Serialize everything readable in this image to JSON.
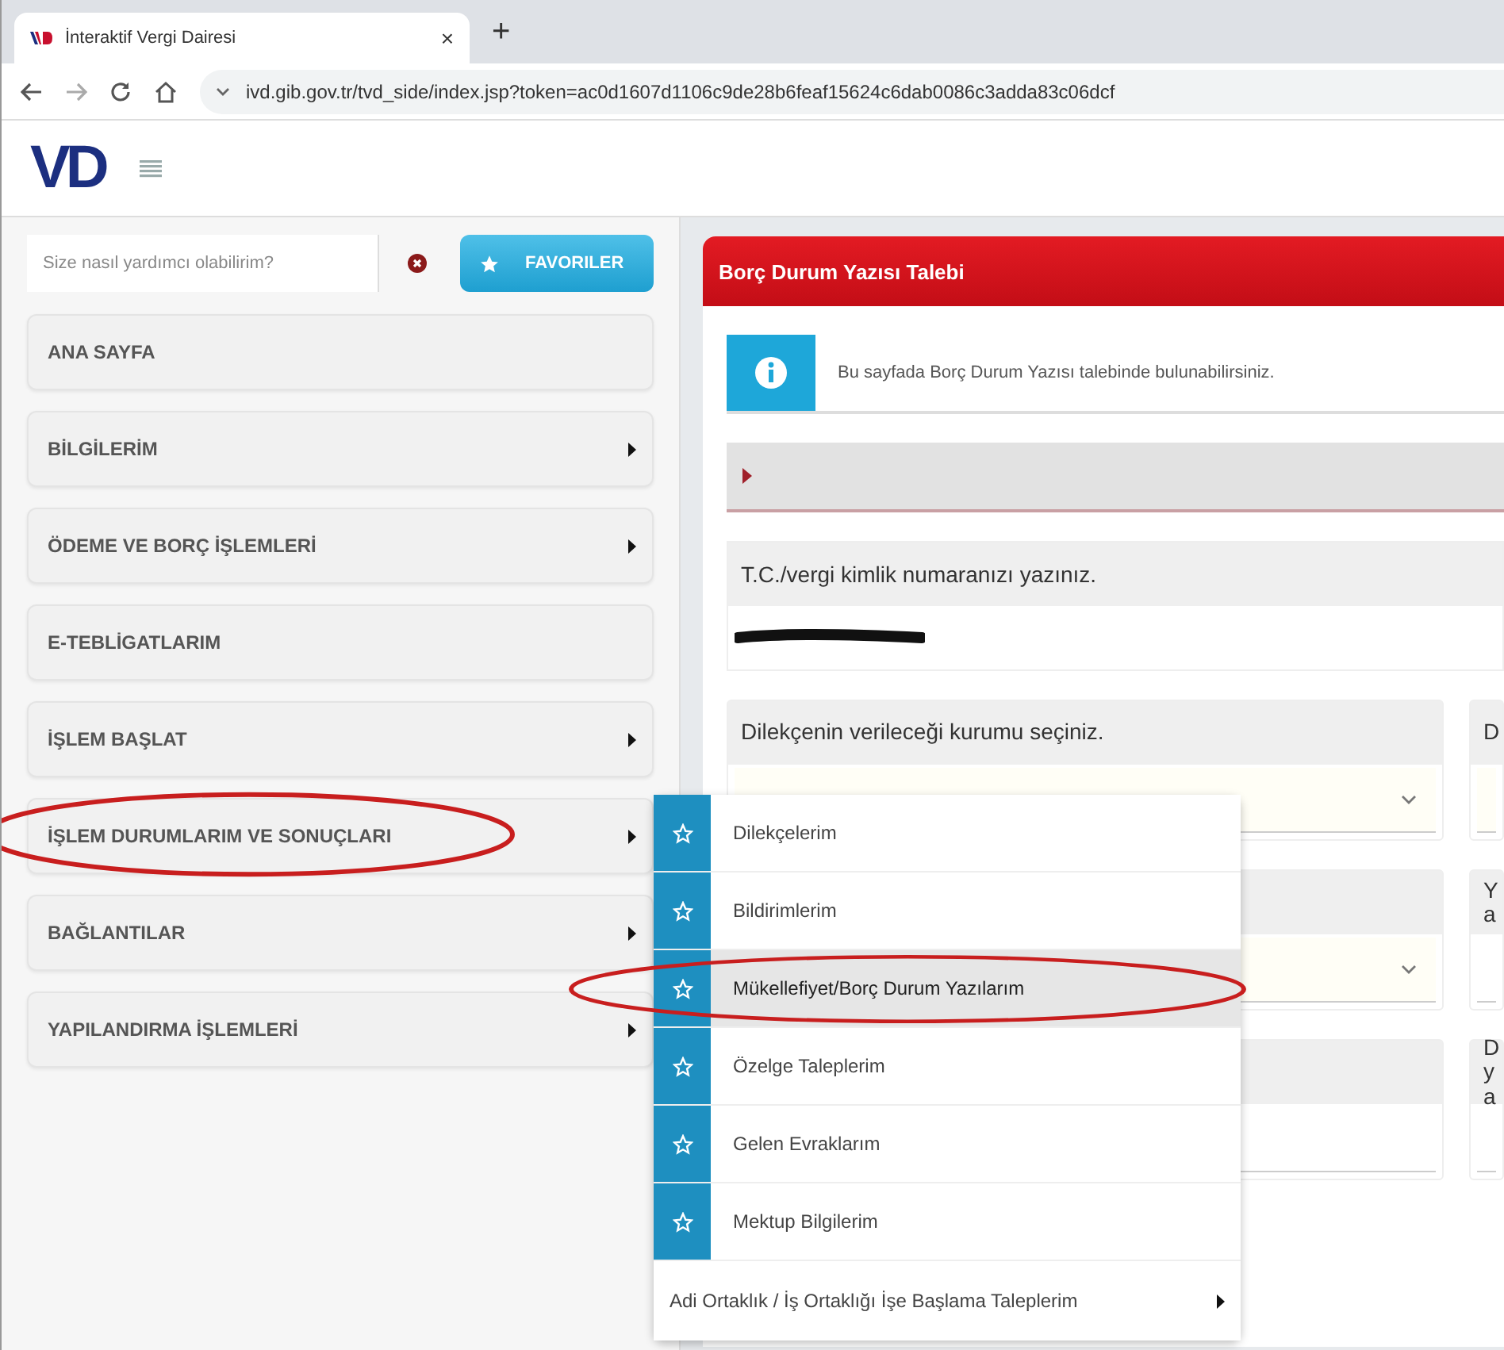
{
  "browser": {
    "tab": {
      "title": "İnteraktif Vergi Dairesi",
      "close": "×"
    },
    "new_tab": "+",
    "address": "ivd.gib.gov.tr/tvd_side/index.jsp?token=ac0d1607d1106c9de28b6feaf15624c6dab0086c3adda83c06dcf"
  },
  "header": {
    "logo": "VD"
  },
  "sidebar": {
    "search": {
      "placeholder": "Size nasıl yardımcı olabilirim?"
    },
    "favorites_button": "FAVORILER",
    "items": [
      {
        "label": "ANA SAYFA",
        "has_submenu": false,
        "circled": false
      },
      {
        "label": "BİLGİLERİM",
        "has_submenu": true,
        "circled": false
      },
      {
        "label": "ÖDEME VE BORÇ İŞLEMLERİ",
        "has_submenu": true,
        "circled": false
      },
      {
        "label": "E-TEBLİGATLARIM",
        "has_submenu": false,
        "circled": false
      },
      {
        "label": "İŞLEM BAŞLAT",
        "has_submenu": true,
        "circled": false
      },
      {
        "label": "İŞLEM DURUMLARIM VE SONUÇLARI",
        "has_submenu": true,
        "circled": true
      },
      {
        "label": "BAĞLANTILAR",
        "has_submenu": true,
        "circled": false
      },
      {
        "label": "YAPILANDIRMA İŞLEMLERİ",
        "has_submenu": true,
        "circled": false
      }
    ]
  },
  "submenu": {
    "items": [
      {
        "kind": "favorite",
        "label": "Dilekçelerim",
        "selected": false,
        "circled": false
      },
      {
        "kind": "favorite",
        "label": "Bildirimlerim",
        "selected": false,
        "circled": false
      },
      {
        "kind": "favorite",
        "label": "Mükellefiyet/Borç Durum Yazılarım",
        "selected": true,
        "circled": true
      },
      {
        "kind": "favorite",
        "label": "Özelge Taleplerim",
        "selected": false,
        "circled": false
      },
      {
        "kind": "favorite",
        "label": "Gelen Evraklarım",
        "selected": false,
        "circled": false
      },
      {
        "kind": "favorite",
        "label": "Mektup Bilgilerim",
        "selected": false,
        "circled": false
      },
      {
        "kind": "submenu",
        "label": "Adi Ortaklık / İş Ortaklığı İşe Başlama Taleplerim",
        "selected": false,
        "circled": false
      }
    ]
  },
  "panel": {
    "title": "Borç Durum Yazısı Talebi",
    "info": "Bu sayfada Borç Durum Yazısı talebinde bulunabilirsiniz.",
    "id_field": {
      "label": "T.C./vergi kimlik numaranızı yazınız.",
      "redacted": true
    },
    "form_rows": [
      [
        {
          "kind": "select",
          "label": "Dilekçenin verileceği kurumu seçiniz."
        },
        {
          "kind": "select",
          "label": "D"
        }
      ],
      [
        {
          "kind": "select"
        },
        {
          "kind": "text",
          "label": "Ya"
        }
      ],
      [
        {
          "kind": "text"
        },
        {
          "kind": "text",
          "label": "D ya"
        }
      ]
    ]
  }
}
